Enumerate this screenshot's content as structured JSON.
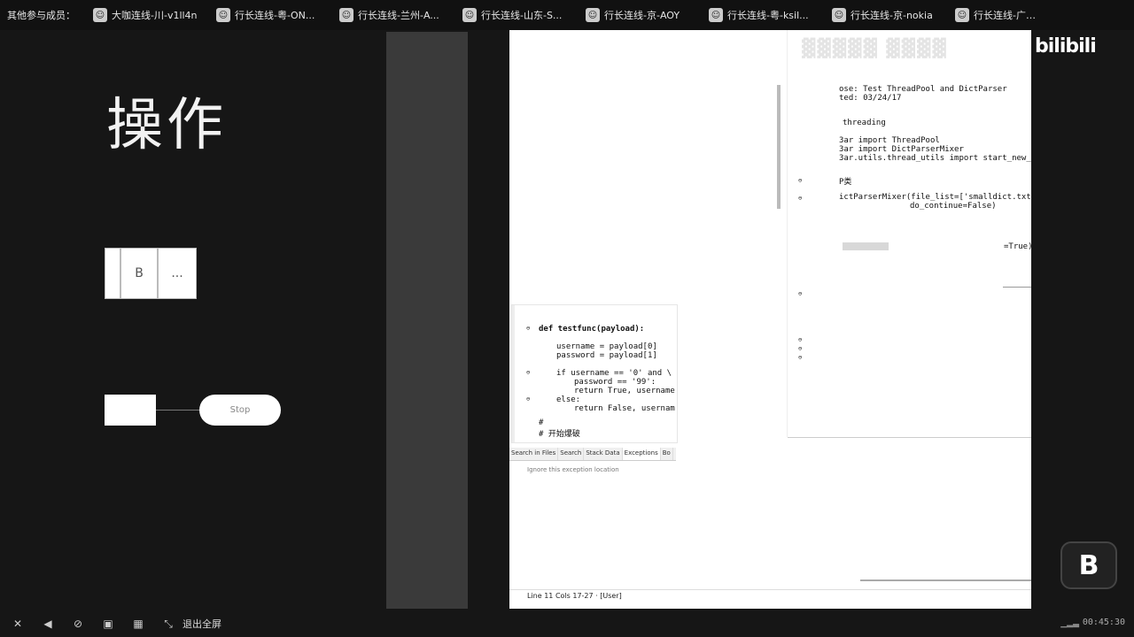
{
  "topbar": {
    "label": "其他参与成员：",
    "participants": [
      {
        "name": "大咖连线-川-v1ll4n"
      },
      {
        "name": "行长连线-粤-ON..."
      },
      {
        "name": "行长连线-兰州-A..."
      },
      {
        "name": "行长连线-山东-S..."
      },
      {
        "name": "行长连线-京-AOY"
      },
      {
        "name": "行长连线-粤-ksil..."
      },
      {
        "name": "行长连线-京-nokia"
      },
      {
        "name": "行长连线-广州-w..."
      }
    ]
  },
  "slide": {
    "title": "操作",
    "cells": [
      "",
      "B",
      "..."
    ],
    "flow_stop": "Stop"
  },
  "ide": {
    "code_right": [
      "ose: Test ThreadPool and DictParser",
      "ted: 03/24/17",
      "threading",
      "3ar import ThreadPool",
      "3ar import DictParserMixer",
      "3ar.utils.thread_utils import start_new_t",
      "P类",
      "ictParserMixer(file_list=['smalldict.txt'",
      "do_continue=False)",
      "=True)"
    ],
    "code_left": [
      "def testfunc(payload):",
      "username = payload[0]",
      "password = payload[1]",
      "if username == '0' and \\",
      "password == '99':",
      "return True, username",
      "else:",
      "return False, usernam",
      "#",
      "# 开始爆破"
    ],
    "tabs": [
      "Search in Files",
      "Search",
      "Stack Data",
      "Exceptions",
      "Bo"
    ],
    "active_tab": "Exceptions",
    "ignore_text": "Ignore this exception location",
    "status": "Line 11 Cols 17-27 · [User]"
  },
  "brand": {
    "logo": "bilibili",
    "badge": "B"
  },
  "bottombar": {
    "exit_fullscreen": "退出全屏",
    "timecode": "00:45:30"
  }
}
